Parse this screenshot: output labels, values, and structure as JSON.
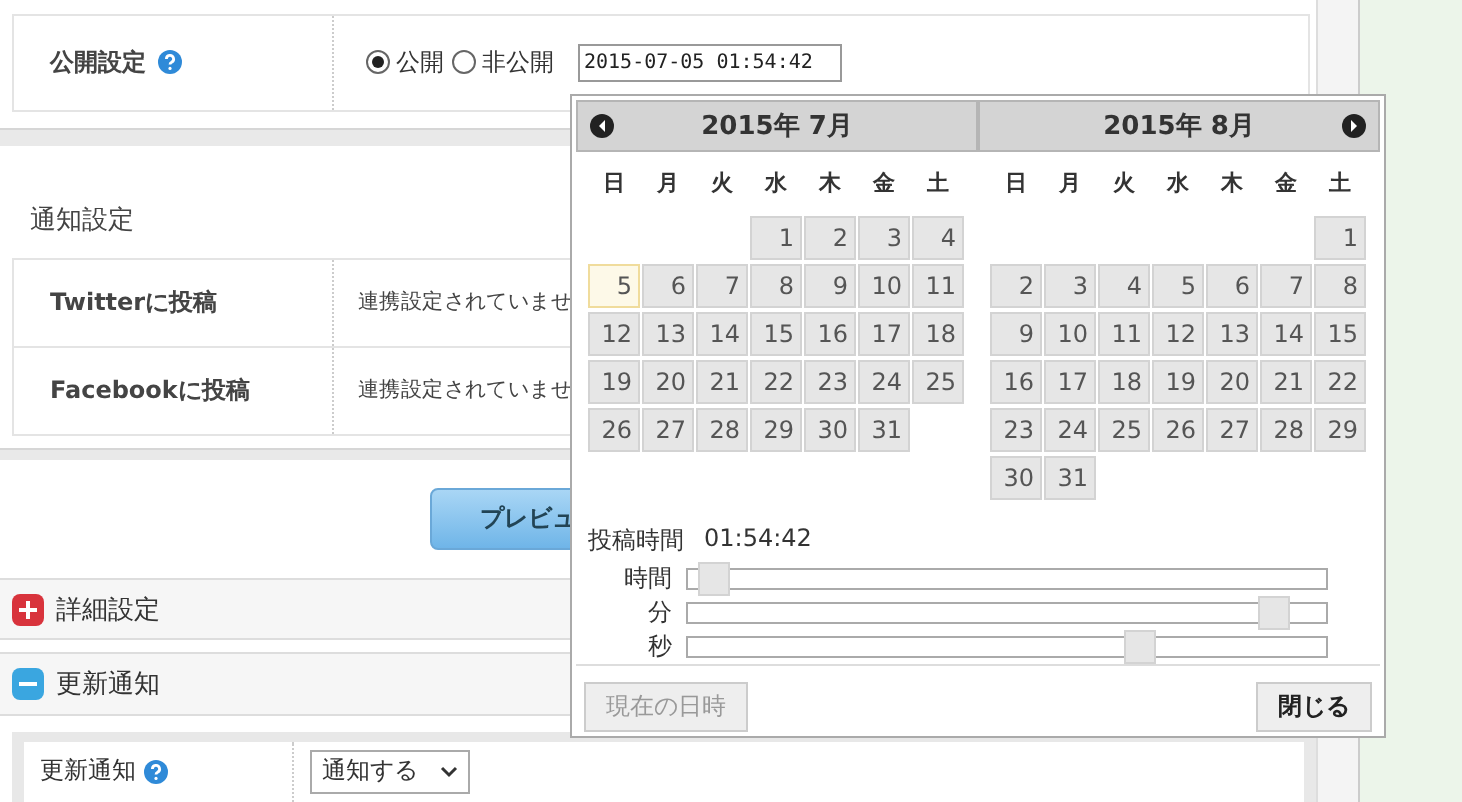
{
  "publish": {
    "label": "公開設定",
    "options": [
      {
        "label": "公開",
        "selected": true
      },
      {
        "label": "非公開",
        "selected": false
      }
    ],
    "datetime_value": "2015-07-05 01:54:42"
  },
  "notify": {
    "heading": "通知設定",
    "rows": [
      {
        "label": "Twitterに投稿",
        "value": "連携設定されていませ"
      },
      {
        "label": "Facebookに投稿",
        "value": "連携設定されていませ"
      }
    ]
  },
  "preview_button": "プレビュ",
  "sections": [
    {
      "title": "詳細設定",
      "expanded": false
    },
    {
      "title": "更新通知",
      "expanded": true
    }
  ],
  "update_notice": {
    "label": "更新通知",
    "select_value": "通知する"
  },
  "datepicker": {
    "months": [
      {
        "title": "2015年 7月",
        "weekdays": [
          "日",
          "月",
          "火",
          "水",
          "木",
          "金",
          "土"
        ],
        "weeks": [
          [
            {
              "kind": "blank"
            },
            {
              "kind": "blank"
            },
            {
              "kind": "blank"
            },
            {
              "kind": "day",
              "day": "1",
              "today": false
            },
            {
              "kind": "day",
              "day": "2",
              "today": false
            },
            {
              "kind": "day",
              "day": "3",
              "today": false
            },
            {
              "kind": "day",
              "day": "4",
              "today": false
            }
          ],
          [
            {
              "kind": "day",
              "day": "5",
              "today": true
            },
            {
              "kind": "day",
              "day": "6",
              "today": false
            },
            {
              "kind": "day",
              "day": "7",
              "today": false
            },
            {
              "kind": "day",
              "day": "8",
              "today": false
            },
            {
              "kind": "day",
              "day": "9",
              "today": false
            },
            {
              "kind": "day",
              "day": "10",
              "today": false
            },
            {
              "kind": "day",
              "day": "11",
              "today": false
            }
          ],
          [
            {
              "kind": "day",
              "day": "12",
              "today": false
            },
            {
              "kind": "day",
              "day": "13",
              "today": false
            },
            {
              "kind": "day",
              "day": "14",
              "today": false
            },
            {
              "kind": "day",
              "day": "15",
              "today": false
            },
            {
              "kind": "day",
              "day": "16",
              "today": false
            },
            {
              "kind": "day",
              "day": "17",
              "today": false
            },
            {
              "kind": "day",
              "day": "18",
              "today": false
            }
          ],
          [
            {
              "kind": "day",
              "day": "19",
              "today": false
            },
            {
              "kind": "day",
              "day": "20",
              "today": false
            },
            {
              "kind": "day",
              "day": "21",
              "today": false
            },
            {
              "kind": "day",
              "day": "22",
              "today": false
            },
            {
              "kind": "day",
              "day": "23",
              "today": false
            },
            {
              "kind": "day",
              "day": "24",
              "today": false
            },
            {
              "kind": "day",
              "day": "25",
              "today": false
            }
          ],
          [
            {
              "kind": "day",
              "day": "26",
              "today": false
            },
            {
              "kind": "day",
              "day": "27",
              "today": false
            },
            {
              "kind": "day",
              "day": "28",
              "today": false
            },
            {
              "kind": "day",
              "day": "29",
              "today": false
            },
            {
              "kind": "day",
              "day": "30",
              "today": false
            },
            {
              "kind": "day",
              "day": "31",
              "today": false
            }
          ]
        ]
      },
      {
        "title": "2015年 8月",
        "weekdays": [
          "日",
          "月",
          "火",
          "水",
          "木",
          "金",
          "土"
        ],
        "weeks": [
          [
            {
              "kind": "blank"
            },
            {
              "kind": "blank"
            },
            {
              "kind": "blank"
            },
            {
              "kind": "blank"
            },
            {
              "kind": "blank"
            },
            {
              "kind": "blank"
            },
            {
              "kind": "day",
              "day": "1",
              "today": false
            }
          ],
          [
            {
              "kind": "day",
              "day": "2",
              "today": false
            },
            {
              "kind": "day",
              "day": "3",
              "today": false
            },
            {
              "kind": "day",
              "day": "4",
              "today": false
            },
            {
              "kind": "day",
              "day": "5",
              "today": false
            },
            {
              "kind": "day",
              "day": "6",
              "today": false
            },
            {
              "kind": "day",
              "day": "7",
              "today": false
            },
            {
              "kind": "day",
              "day": "8",
              "today": false
            }
          ],
          [
            {
              "kind": "day",
              "day": "9",
              "today": false
            },
            {
              "kind": "day",
              "day": "10",
              "today": false
            },
            {
              "kind": "day",
              "day": "11",
              "today": false
            },
            {
              "kind": "day",
              "day": "12",
              "today": false
            },
            {
              "kind": "day",
              "day": "13",
              "today": false
            },
            {
              "kind": "day",
              "day": "14",
              "today": false
            },
            {
              "kind": "day",
              "day": "15",
              "today": false
            }
          ],
          [
            {
              "kind": "day",
              "day": "16",
              "today": false
            },
            {
              "kind": "day",
              "day": "17",
              "today": false
            },
            {
              "kind": "day",
              "day": "18",
              "today": false
            },
            {
              "kind": "day",
              "day": "19",
              "today": false
            },
            {
              "kind": "day",
              "day": "20",
              "today": false
            },
            {
              "kind": "day",
              "day": "21",
              "today": false
            },
            {
              "kind": "day",
              "day": "22",
              "today": false
            }
          ],
          [
            {
              "kind": "day",
              "day": "23",
              "today": false
            },
            {
              "kind": "day",
              "day": "24",
              "today": false
            },
            {
              "kind": "day",
              "day": "25",
              "today": false
            },
            {
              "kind": "day",
              "day": "26",
              "today": false
            },
            {
              "kind": "day",
              "day": "27",
              "today": false
            },
            {
              "kind": "day",
              "day": "28",
              "today": false
            },
            {
              "kind": "day",
              "day": "29",
              "today": false
            }
          ],
          [
            {
              "kind": "day",
              "day": "30",
              "today": false
            },
            {
              "kind": "day",
              "day": "31",
              "today": false
            }
          ]
        ]
      }
    ],
    "time_label": "投稿時間",
    "time_value": "01:54:42",
    "sliders": [
      {
        "label": "時間",
        "level": 0.04
      },
      {
        "label": "分",
        "level": 0.92
      },
      {
        "label": "秒",
        "level": 0.71
      }
    ],
    "now_button": {
      "label": "現在の日時",
      "disabled": true
    },
    "close_button": "閉じる"
  }
}
